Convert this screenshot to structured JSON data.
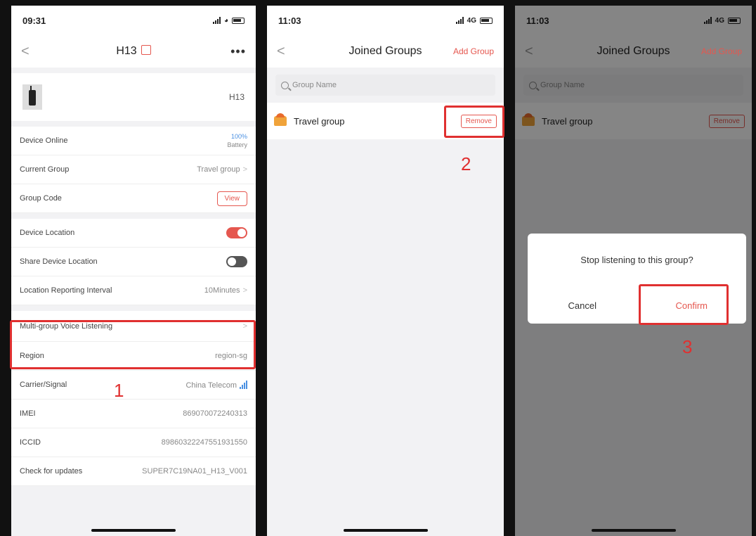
{
  "screen1": {
    "time": "09:31",
    "title": "H13",
    "more": "•••",
    "device_model": "H13",
    "rows": {
      "device_online": {
        "label": "Device Online",
        "battery_pct": "100%",
        "battery_label": "Battery"
      },
      "current_group": {
        "label": "Current Group",
        "value": "Travel group"
      },
      "group_code": {
        "label": "Group Code",
        "button": "View"
      },
      "device_location": {
        "label": "Device Location",
        "state": "on"
      },
      "share_location": {
        "label": "Share Device Location",
        "state": "off"
      },
      "reporting_interval": {
        "label": "Location Reporting Interval",
        "value": "10Minutes"
      },
      "multi_group": {
        "label": "Multi-group Voice Listening"
      },
      "region": {
        "label": "Region",
        "value": "region-sg"
      },
      "carrier": {
        "label": "Carrier/Signal",
        "value": "China Telecom"
      },
      "imei": {
        "label": "IMEI",
        "value": "869070072240313"
      },
      "iccid": {
        "label": "ICCID",
        "value": "89860322247551931550"
      },
      "updates": {
        "label": "Check for updates",
        "value": "SUPER7C19NA01_H13_V001"
      }
    },
    "step": "1"
  },
  "screen2": {
    "time": "11:03",
    "network": "4G",
    "title": "Joined Groups",
    "add_group": "Add Group",
    "search_placeholder": "Group Name",
    "group_name": "Travel group",
    "remove": "Remove",
    "step": "2"
  },
  "screen3": {
    "time": "11:03",
    "network": "4G",
    "title": "Joined Groups",
    "add_group": "Add Group",
    "search_placeholder": "Group Name",
    "group_name": "Travel group",
    "remove": "Remove",
    "dialog_message": "Stop listening to this group?",
    "cancel": "Cancel",
    "confirm": "Confirm",
    "step": "3"
  },
  "colors": {
    "accent": "#e5574f",
    "highlight": "#e03030",
    "link_blue": "#4a90e2"
  }
}
